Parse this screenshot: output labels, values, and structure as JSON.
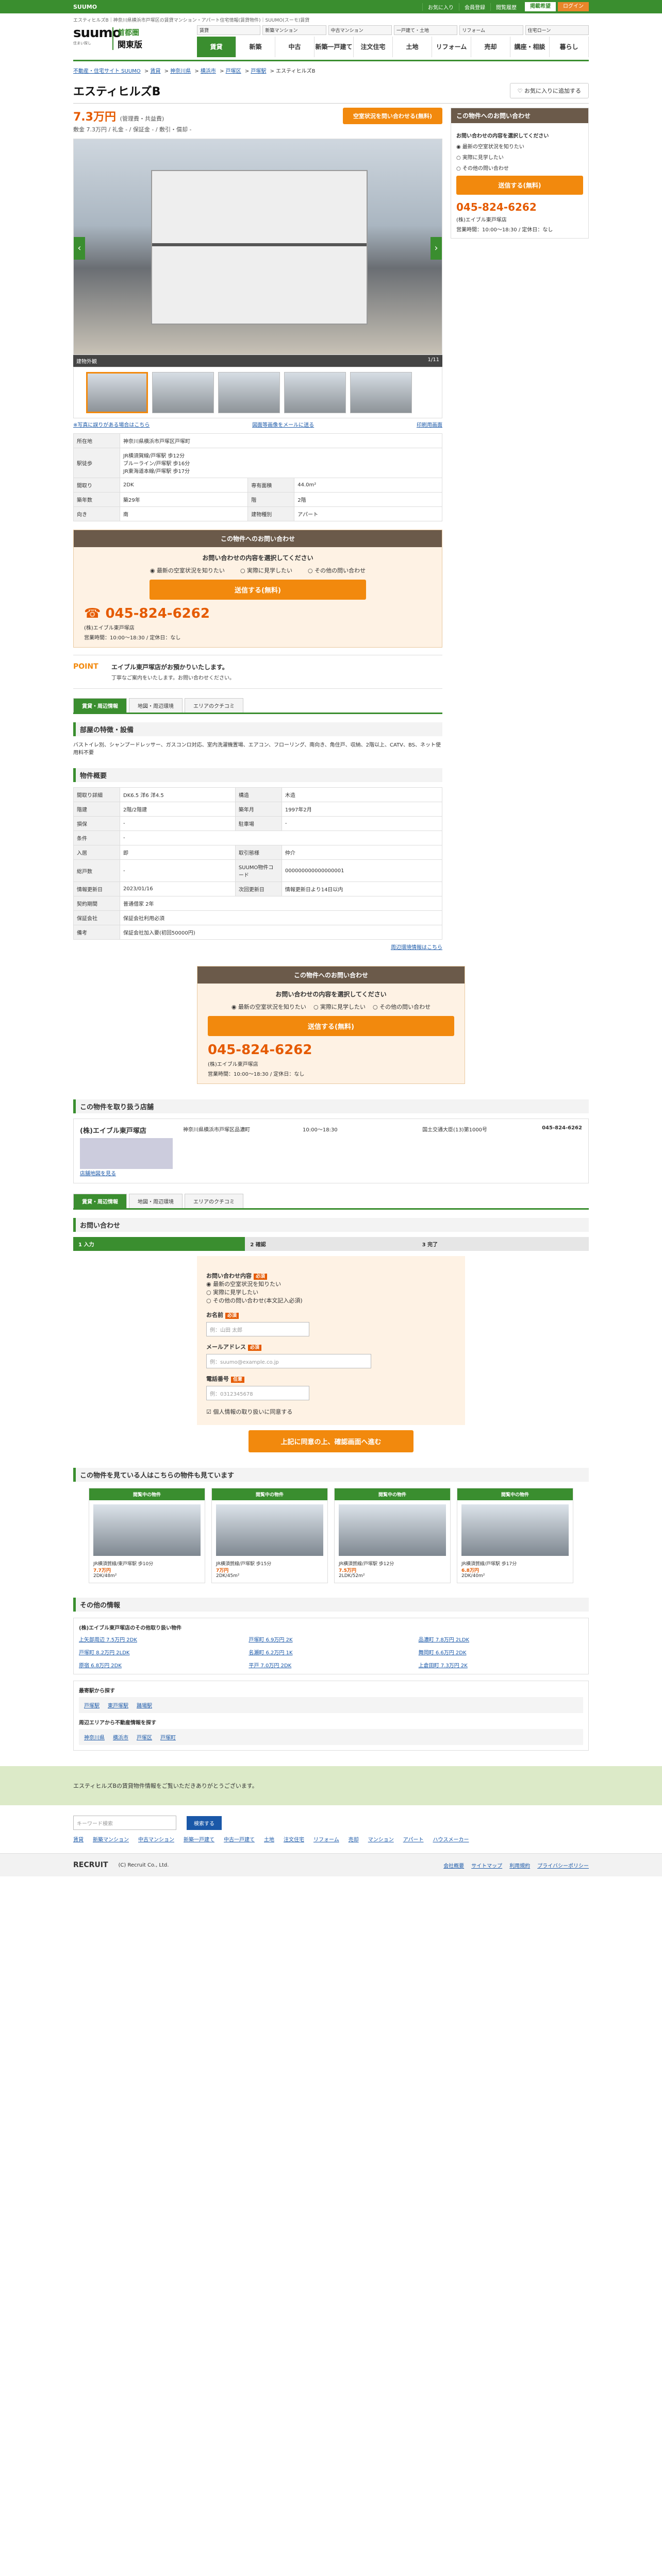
{
  "topbar": {
    "brand": "SUUMO",
    "links": [
      "お気に入り",
      "会員登録",
      "閲覧履歴"
    ],
    "publish": "掲載希望",
    "login": "ログイン"
  },
  "top_note": "エスティヒルズB｜神奈川県横浜市戸塚区の賃貸マンション・アパート住宅情報(賃貸物件)｜SUUMO(スーモ)賃貸",
  "header": {
    "logo": "suumo",
    "logo_sub": "住まい探し",
    "region1": "首都圏",
    "region2": "関東版",
    "sub": [
      "賃貸",
      "新築マンション",
      "中古マンション",
      "一戸建て・土地",
      "リフォーム",
      "住宅ローン"
    ],
    "nav": [
      "賃貸",
      "新築",
      "中古",
      "新築一戸建て",
      "注文住宅",
      "土地",
      "リフォーム",
      "売却",
      "講座・相談",
      "暮らし"
    ]
  },
  "breadcrumb": [
    "不動産・住宅サイト SUUMO",
    "賃貸",
    "神奈川県",
    "横浜市",
    "戸塚区",
    "戸塚駅",
    "エスティヒルズB"
  ],
  "title": "エスティヒルズB",
  "fav": "お気に入りに追加する",
  "price": "7.3万円",
  "price_sub": "(管理費・共益費)",
  "price_detail": "敷金 7.3万円 / 礼金 - / 保証金 - / 敷引・償却 -",
  "cta_top": "空室状況を問い合わせる(無料)",
  "photo": {
    "caption": "建物外観",
    "count": "1/11"
  },
  "notes": {
    "left": "※写真に誤りがある場合はこちら",
    "mid": "図面等画像をメールに送る",
    "right": "印刷用画面"
  },
  "spec_rows": [
    {
      "k": "所在地",
      "v": "神奈川県横浜市戸塚区戸塚町"
    },
    {
      "k": "駅徒歩",
      "v": "JR横須賀線/戸塚駅 歩12分\nブルーライン/戸塚駅 歩16分\nJR東海道本線/戸塚駅 歩17分"
    },
    {
      "k": "間取り",
      "v": "2DK",
      "k2": "専有面積",
      "v2": "44.0m²"
    },
    {
      "k": "築年数",
      "v": "築29年",
      "k2": "階",
      "v2": "2階"
    },
    {
      "k": "向き",
      "v": "南",
      "k2": "建物種別",
      "v2": "アパート"
    }
  ],
  "inquiry": {
    "head": "この物件へのお問い合わせ",
    "q": "お問い合わせの内容を選択してください",
    "options": [
      "最新の空室状況を知りたい",
      "実際に見学したい",
      "その他の問い合わせ"
    ],
    "send": "送信する(無料)",
    "phone": "045-824-6262",
    "agent": "(株)エイブル東戸塚店",
    "hours": "営業時間：10:00～18:30 / 定休日：なし"
  },
  "point": {
    "label": "POINT",
    "title": "エイブル東戸塚店がお預かりいたします。",
    "body": "丁寧なご案内をいたします。お問い合わせください。"
  },
  "tabs": [
    "賃貸・周辺情報",
    "地図・周辺環境",
    "エリアのクチコミ"
  ],
  "features_head": "部屋の特徴・設備",
  "features": "バストイレ別、シャンプードレッサー、ガスコンロ対応、室内洗濯機置場、エアコン、フローリング、南向き、角住戸、収納、2階以上、CATV、BS、ネット使用料不要",
  "details_head": "物件概要",
  "details": [
    {
      "k": "間取り詳細",
      "v": "DK6.5 洋6 洋4.5",
      "k2": "構造",
      "v2": "木造"
    },
    {
      "k": "階建",
      "v": "2階/2階建",
      "k2": "築年月",
      "v2": "1997年2月"
    },
    {
      "k": "損保",
      "v": "-",
      "k2": "駐車場",
      "v2": "-"
    },
    {
      "k": "条件",
      "v": "-",
      "k2": "",
      "v2": ""
    },
    {
      "k": "入居",
      "v": "即",
      "k2": "取引態様",
      "v2": "仲介"
    },
    {
      "k": "総戸数",
      "v": "-",
      "k2": "SUUMO物件コード",
      "v2": "000000000000000001"
    },
    {
      "k": "情報更新日",
      "v": "2023/01/16",
      "k2": "次回更新日",
      "v2": "情報更新日より14日以内"
    },
    {
      "k": "契約期間",
      "v": "普通借家 2年",
      "k2": "",
      "v2": ""
    },
    {
      "k": "保証会社",
      "v": "保証会社利用必須",
      "k2": "",
      "v2": ""
    },
    {
      "k": "備考",
      "v": "保証会社加入要(初回50000円)",
      "k2": "",
      "v2": ""
    }
  ],
  "details_note": "周辺環境情報はこちら",
  "agency_head": "この物件を取り扱う店舗",
  "agency": {
    "name": "(株)エイブル東戸塚店",
    "addr": "神奈川県横浜市戸塚区品濃町",
    "hours": "10:00～18:30",
    "holiday": "なし",
    "license": "国土交通大臣(13)第1000号",
    "tel": "045-824-6262",
    "map": "店舗地図を見る"
  },
  "form": {
    "head": "お問い合わせ",
    "steps": [
      "1 入力",
      "2 確認",
      "3 完了"
    ],
    "q_label": "お問い合わせ内容",
    "options": [
      "最新の空室状況を知りたい",
      "実際に見学したい",
      "その他の問い合わせ(本文記入必須)"
    ],
    "name_label": "お名前",
    "name_ph": "例：山田 太郎",
    "mail_label": "メールアドレス",
    "mail_ph": "例：suumo@example.co.jp",
    "tel_label": "電話番号",
    "tel_ph": "例：0312345678",
    "agree": "個人情報の取り扱いに同意する",
    "submit": "上記に同意の上、確認画面へ進む",
    "required": "必須",
    "any": "任意"
  },
  "rec_head": "この物件を見ている人はこちらの物件も見ています",
  "rec": [
    {
      "label": "閲覧中の物件",
      "name": "JR横須賀線/東戸塚駅 歩10分",
      "price": "7.7万円",
      "detail": "2DK/48m²"
    },
    {
      "label": "閲覧中の物件",
      "name": "JR横須賀線/戸塚駅 歩15分",
      "price": "7万円",
      "detail": "2DK/45m²"
    },
    {
      "label": "閲覧中の物件",
      "name": "JR横須賀線/戸塚駅 歩12分",
      "price": "7.5万円",
      "detail": "2LDK/52m²"
    },
    {
      "label": "閲覧中の物件",
      "name": "JR横須賀線/戸塚駅 歩17分",
      "price": "6.8万円",
      "detail": "2DK/40m²"
    }
  ],
  "other_head": "その他の情報",
  "other_sub": "(株)エイブル東戸塚店のその他取り扱い物件",
  "other": [
    "上矢部周辺 7.5万円 2DK",
    "戸塚町 6.9万円 2K",
    "品濃町 7.8万円 2LDK",
    "戸塚町 8.2万円 2LDK",
    "名瀬町 6.2万円 1K",
    "舞岡町 6.6万円 2DK",
    "原宿 6.8万円 2DK",
    "平戸 7.0万円 2DK",
    "上倉田町 7.3万円 2K"
  ],
  "near_head": "最寄駅から探す",
  "near": [
    "戸塚駅",
    "東戸塚駅",
    "踊場駅"
  ],
  "area_head": "周辺エリアから不動産情報を探す",
  "area": [
    "神奈川県",
    "横浜市",
    "戸塚区",
    "戸塚町"
  ],
  "footer": {
    "msg": "エスティヒルズBの賃貸物件情報をご覧いただきありがとうございます。",
    "search_ph": "キーワード検索",
    "search_btn": "検索する",
    "links": [
      "賃貸",
      "新築マンション",
      "中古マンション",
      "新築一戸建て",
      "中古一戸建て",
      "土地",
      "注文住宅",
      "リフォーム",
      "売却",
      "マンション",
      "アパート",
      "ハウスメーカー"
    ],
    "bottom": [
      "会社概要",
      "サイトマップ",
      "利用規約",
      "プライバシーポリシー"
    ],
    "copy": "(C) Recruit Co., Ltd.",
    "brand": "RECRUIT"
  }
}
